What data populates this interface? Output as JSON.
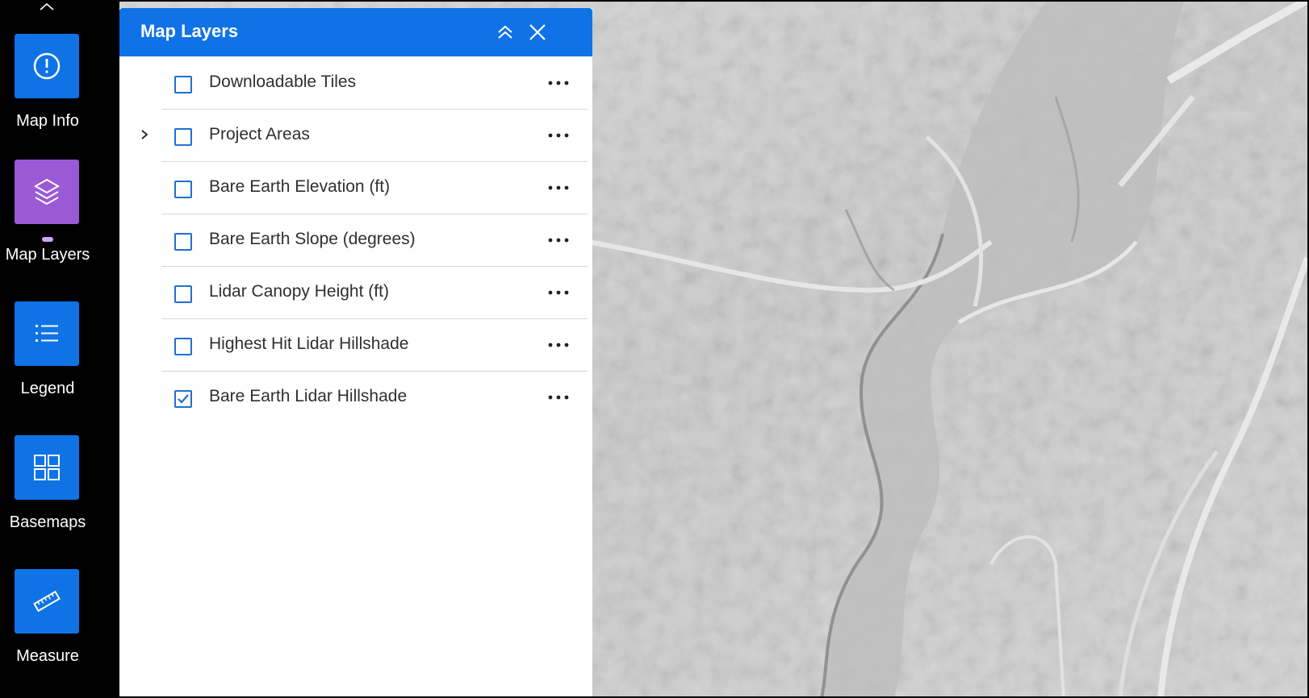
{
  "toolbar": {
    "items": [
      {
        "label": "Map Info",
        "icon": "info-icon",
        "active": false
      },
      {
        "label": "Map Layers",
        "icon": "layers-icon",
        "active": true
      },
      {
        "label": "Legend",
        "icon": "list-icon",
        "active": false
      },
      {
        "label": "Basemaps",
        "icon": "grid-icon",
        "active": false
      },
      {
        "label": "Measure",
        "icon": "ruler-icon",
        "active": false
      }
    ]
  },
  "panel": {
    "title": "Map Layers",
    "collapse_icon": "chevron-double-up-icon",
    "close_icon": "close-icon",
    "layers": [
      {
        "label": "Downloadable Tiles",
        "checked": false,
        "expandable": false
      },
      {
        "label": "Project Areas",
        "checked": false,
        "expandable": true
      },
      {
        "label": "Bare Earth Elevation (ft)",
        "checked": false,
        "expandable": false
      },
      {
        "label": "Bare Earth Slope (degrees)",
        "checked": false,
        "expandable": false
      },
      {
        "label": "Lidar Canopy Height (ft)",
        "checked": false,
        "expandable": false
      },
      {
        "label": "Highest Hit Lidar Hillshade",
        "checked": false,
        "expandable": false
      },
      {
        "label": "Bare Earth Lidar Hillshade",
        "checked": true,
        "expandable": false
      }
    ]
  },
  "colors": {
    "accent": "#0f73e6",
    "active_tool": "#9b59d6",
    "checkbox_border": "#1f6fd1"
  }
}
